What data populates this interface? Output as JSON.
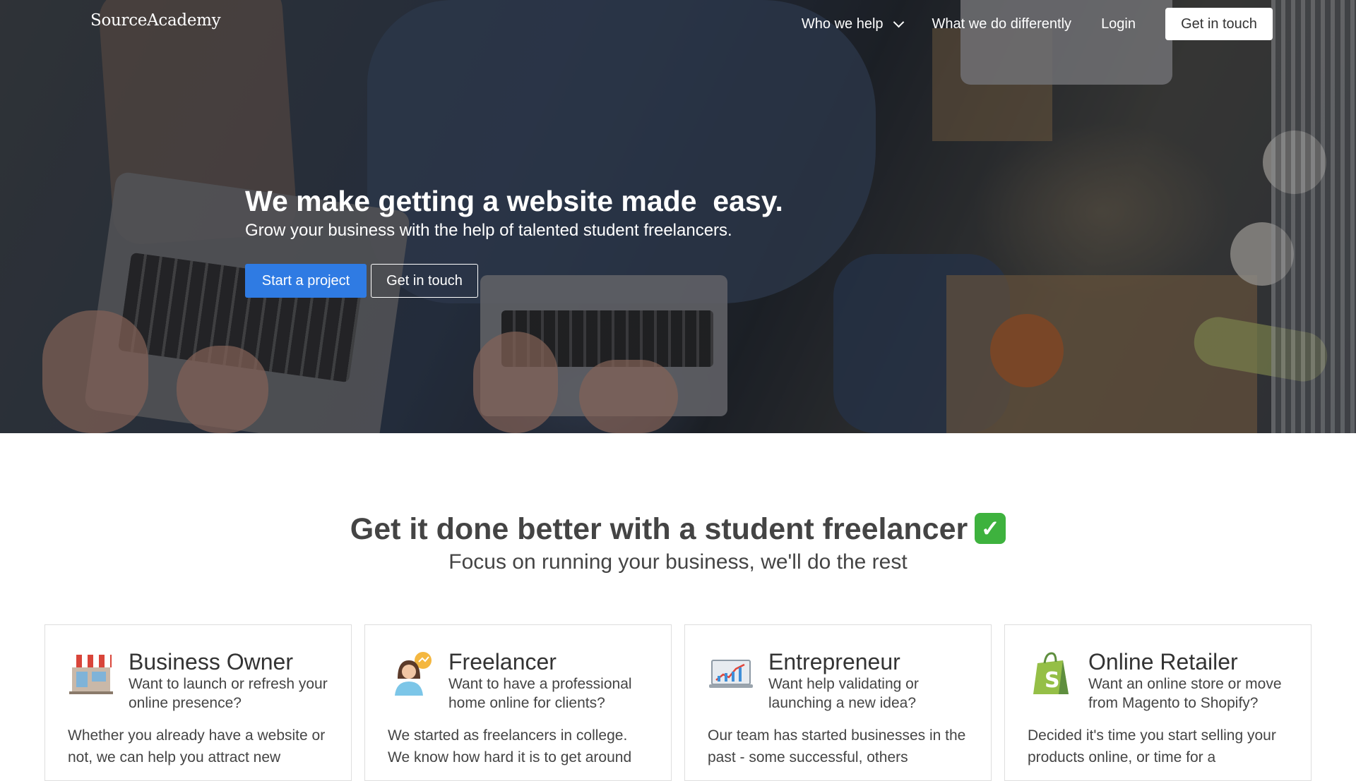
{
  "brand": "SourceAcademy",
  "nav": {
    "who_we_help": "Who we help",
    "what_we_do": "What we do differently",
    "login": "Login",
    "cta": "Get in touch"
  },
  "hero": {
    "title": "We make getting a website made  easy.",
    "subtitle": "Grow your business with the help of talented student freelancers.",
    "primary_button": "Start a project",
    "secondary_button": "Get in touch"
  },
  "section": {
    "title": "Get it done better with a student freelancer",
    "title_emoji": "✓",
    "subtitle": "Focus on running your business, we'll do the rest"
  },
  "cards": [
    {
      "icon": "storefront-icon",
      "title": "Business Owner",
      "question": "Want to launch or refresh your online presence?",
      "body": "Whether you already have a website or not, we can help you attract new"
    },
    {
      "icon": "freelancer-woman-icon",
      "title": "Freelancer",
      "question": "Want to have a professional home online for clients?",
      "body": "We started as freelancers in college. We know how hard it is to get around"
    },
    {
      "icon": "chart-laptop-icon",
      "title": "Entrepreneur",
      "question": "Want help validating or launching a new idea?",
      "body": "Our team has started businesses in the past - some successful, others"
    },
    {
      "icon": "shopify-bag-icon",
      "title": "Online Retailer",
      "question": "Want an online store or move from Magento to Shopify?",
      "body": "Decided it's time you start selling your products online, or time for a"
    }
  ],
  "colors": {
    "primary": "#2f7be3",
    "check": "#3eb23e",
    "shopify": "#95bf47"
  }
}
